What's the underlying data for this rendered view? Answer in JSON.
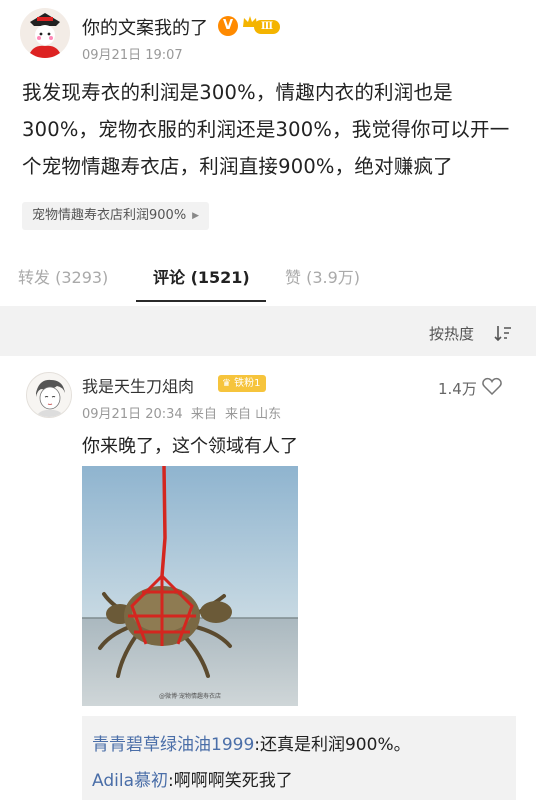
{
  "post": {
    "author": "你的文案我的了",
    "verified_icon": "verified-v-icon",
    "level_badge": "Ⅲ",
    "time": "09月21日 19:07",
    "text": "我发现寿衣的利润是300%，情趣内衣的利润也是300%，宠物衣服的利润还是300%，我觉得你可以开一个宠物情趣寿衣店，利润直接900%，绝对赚疯了",
    "topic": "宠物情趣寿衣店利润900%"
  },
  "tabs": {
    "repost": "转发 (3293)",
    "comments": "评论 (1521)",
    "likes": "赞 (3.9万)"
  },
  "sort": {
    "label": "按热度"
  },
  "comment": {
    "author": "我是天生刀俎肉",
    "fan_badge": "铁粉1",
    "date": "09月21日 20:34",
    "source1": "来自",
    "source2": "来自 山东",
    "likes": "1.4万",
    "text": "你来晚了，这个领域有人了",
    "image_watermark": "@微博·宠物情趣寿衣店",
    "replies": [
      {
        "name": "青青碧草绿油油1999",
        "text": ":还真是利润900%。"
      },
      {
        "name": "Adila慕初",
        "text": ":啊啊啊笑死我了"
      }
    ]
  },
  "colors": {
    "link_blue": "#4a6ea8",
    "badge_gold": "#f4b400",
    "verified_orange": "#ff8a00"
  }
}
